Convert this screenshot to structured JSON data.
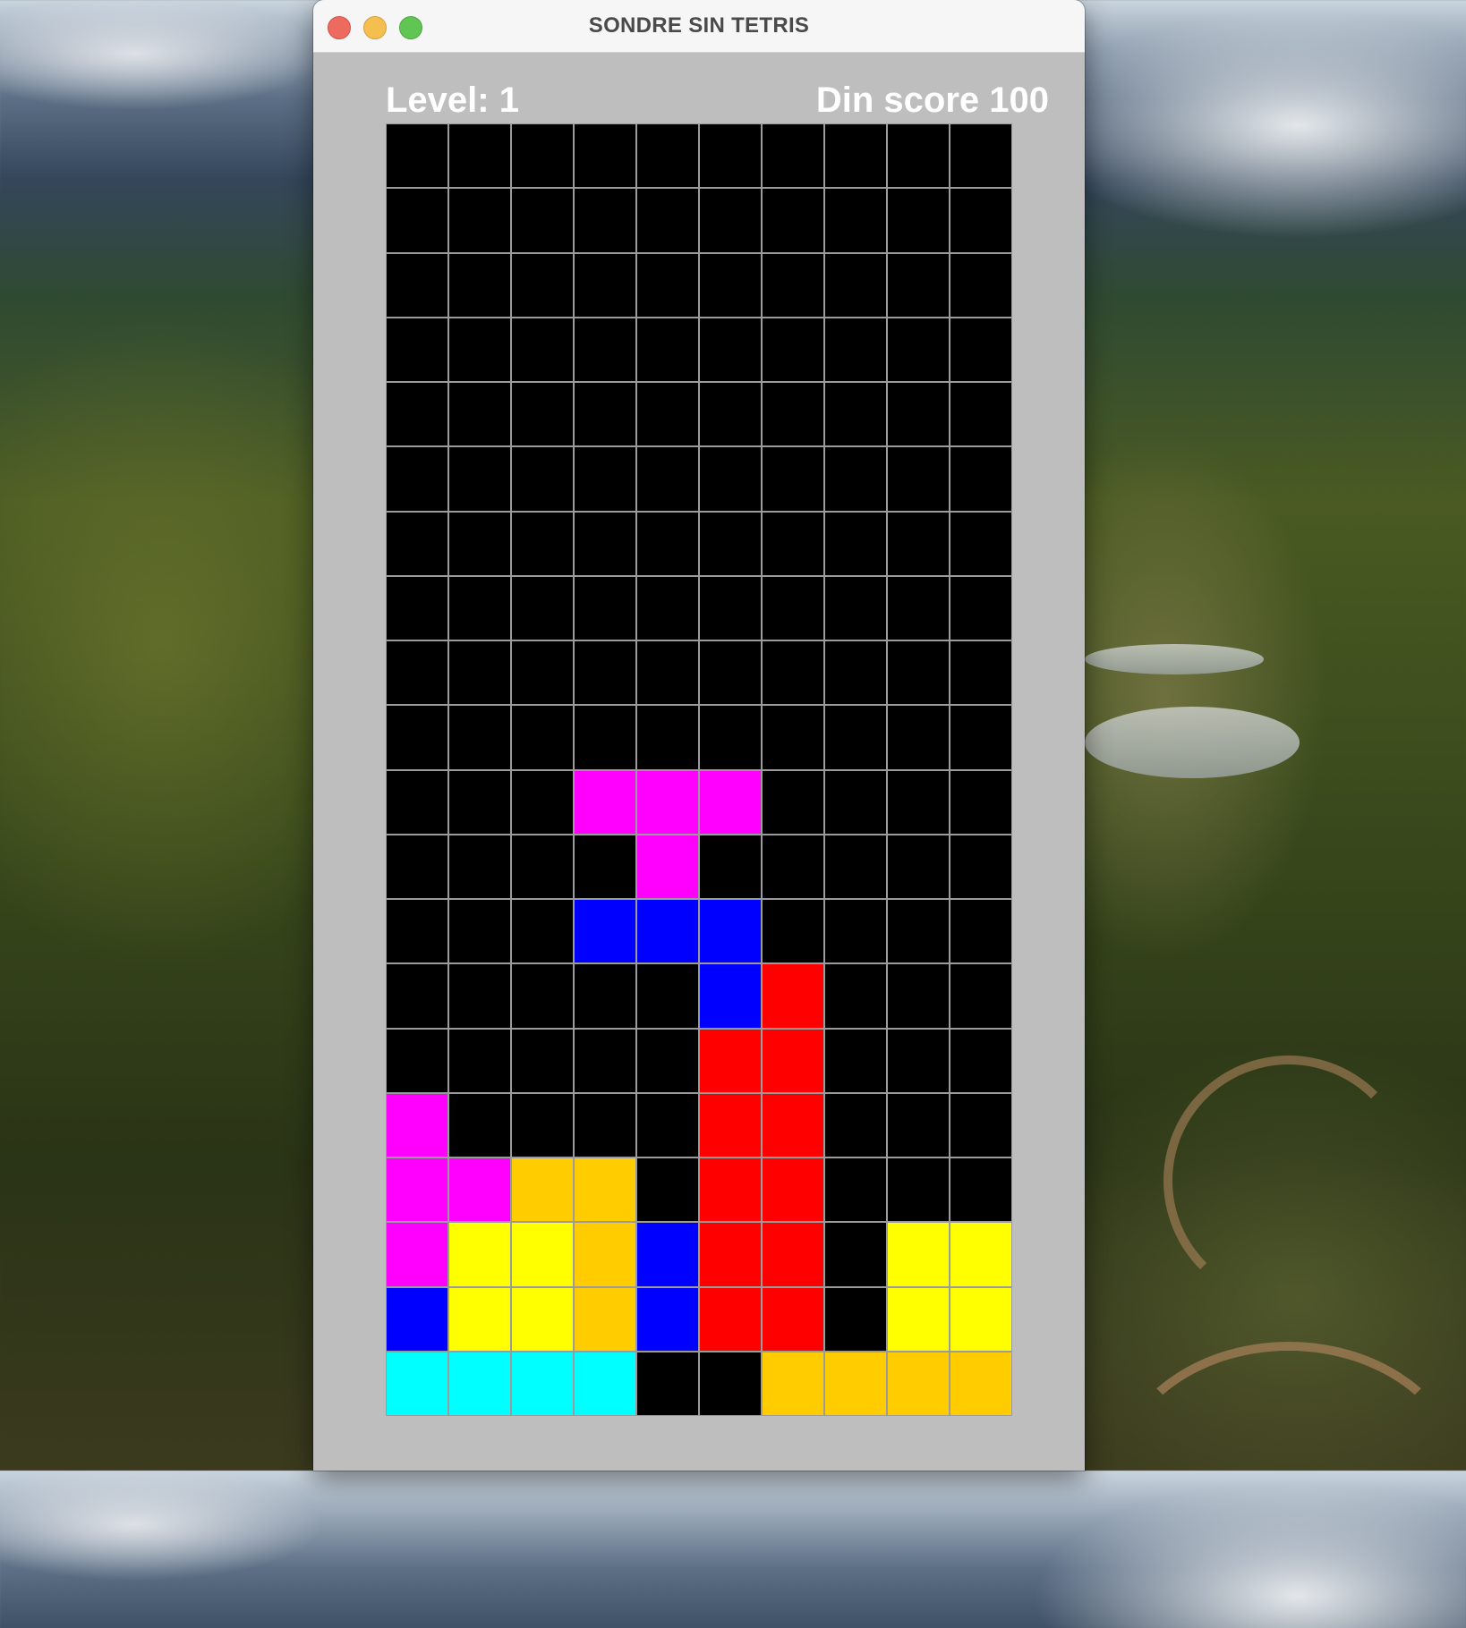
{
  "window": {
    "title": "SONDRE SIN TETRIS"
  },
  "hud": {
    "level_text": "Level: 1",
    "score_text": "Din score 100"
  },
  "board": {
    "columns": 10,
    "rows": 20,
    "palette": {
      ".": "#000000",
      "M": "#ff00ff",
      "B": "#0000ff",
      "R": "#ff0000",
      "Y": "#ffff00",
      "O": "#ffcc00",
      "C": "#00ffff"
    },
    "grid": [
      "..........",
      "..........",
      "..........",
      "..........",
      "..........",
      "..........",
      "..........",
      "..........",
      "..........",
      "..........",
      "...MMM....",
      "....M.....",
      "...BBB....",
      ".....BR...",
      ".....RR...",
      "M....RR...",
      "MMOO.RR...",
      "MYYOBRR.YY",
      "BYYOBRR.YY",
      "CCCC..OOOO"
    ]
  }
}
